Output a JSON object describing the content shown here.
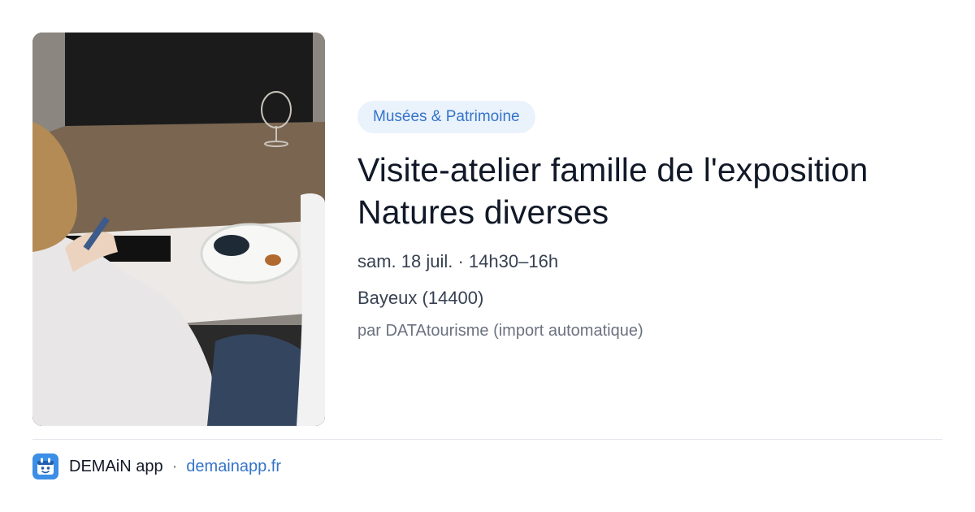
{
  "event": {
    "category": "Musées & Patrimoine",
    "title": "Visite-atelier famille de l'exposition Natures diverses",
    "date": "sam. 18 juil. · 14h30–16h",
    "location": "Bayeux (14400)",
    "source": "par DATAtourisme (import automatique)",
    "image_icon": "event-photo"
  },
  "footer": {
    "app_name": "DEMAiN app",
    "separator": "·",
    "link": "demainapp.fr",
    "logo_icon": "demain-app-logo-icon"
  },
  "colors": {
    "accent": "#3474c9",
    "chip_bg": "#eaf2fc",
    "logo_bg": "#3c8ee6",
    "title": "#111827",
    "muted": "#6b7280"
  }
}
